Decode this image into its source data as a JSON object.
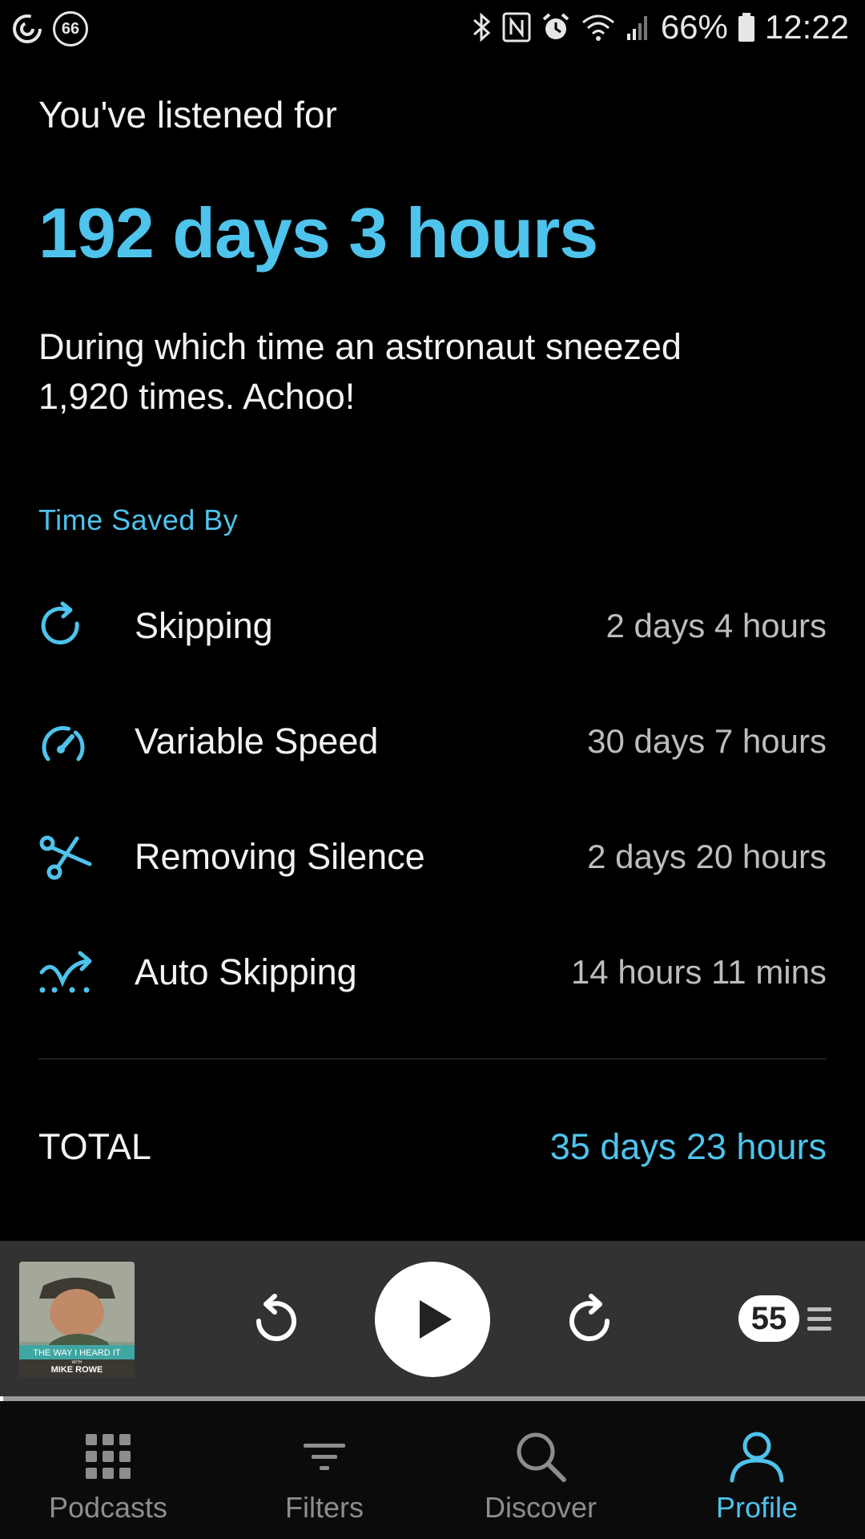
{
  "status_bar": {
    "notification_count": "66",
    "battery": "66%",
    "time": "12:22"
  },
  "listened": {
    "label": "You've listened for",
    "value": "192 days 3 hours",
    "fun_fact": "During which time an astronaut sneezed 1,920 times. Achoo!"
  },
  "time_saved": {
    "title": "Time Saved By",
    "rows": [
      {
        "icon": "skip-forward-icon",
        "label": "Skipping",
        "value": "2 days 4 hours"
      },
      {
        "icon": "speedometer-icon",
        "label": "Variable Speed",
        "value": "30 days 7 hours"
      },
      {
        "icon": "scissors-icon",
        "label": "Removing Silence",
        "value": "2 days 20 hours"
      },
      {
        "icon": "auto-skip-icon",
        "label": "Auto Skipping",
        "value": "14 hours 11 mins"
      }
    ],
    "total_label": "TOTAL",
    "total_value": "35 days 23 hours"
  },
  "player": {
    "artwork_title": "THE WAY I HEARD IT",
    "artwork_with": "WITH",
    "artwork_author": "MIKE ROWE",
    "up_next_count": "55",
    "progress": 0.004
  },
  "tabs": [
    {
      "label": "Podcasts",
      "icon": "grid-icon",
      "active": false
    },
    {
      "label": "Filters",
      "icon": "filter-icon",
      "active": false
    },
    {
      "label": "Discover",
      "icon": "search-icon",
      "active": false
    },
    {
      "label": "Profile",
      "icon": "profile-icon",
      "active": true
    }
  ],
  "colors": {
    "accent": "#4ec3ec",
    "background": "#000000",
    "player_bg": "#323232"
  }
}
